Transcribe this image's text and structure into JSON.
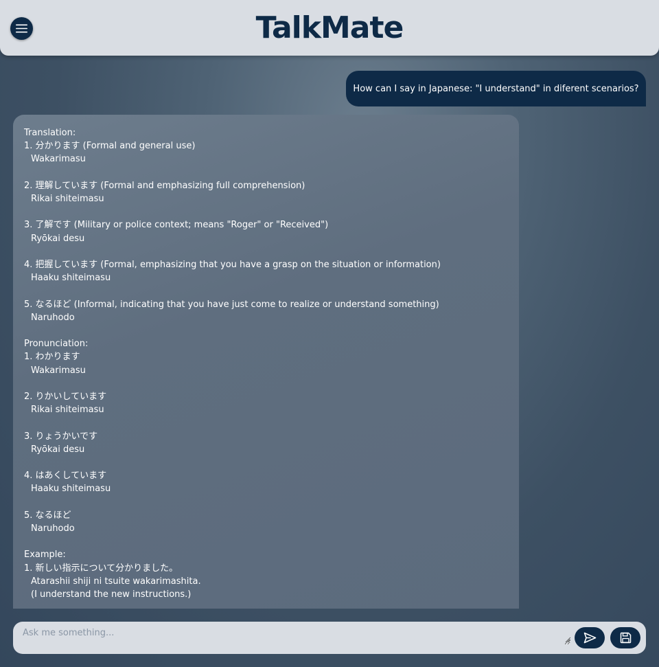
{
  "app": {
    "title": "TalkMate"
  },
  "header": {
    "menu_icon": "hamburger-menu-icon"
  },
  "chat": {
    "user_message": "How can I say in Japanese: \"I understand\" in diferent scenarios?",
    "bot_lines": [
      {
        "text": "Translation:",
        "sub": false
      },
      {
        "text": "1. 分かります (Formal and general use)",
        "sub": false
      },
      {
        "text": "Wakarimasu",
        "sub": true
      },
      {
        "text": "",
        "sub": false
      },
      {
        "text": "2. 理解しています (Formal and emphasizing full comprehension)",
        "sub": false
      },
      {
        "text": "Rikai shiteimasu",
        "sub": true
      },
      {
        "text": "",
        "sub": false
      },
      {
        "text": "3. 了解です (Military or police context; means \"Roger\" or \"Received\")",
        "sub": false
      },
      {
        "text": "Ryōkai desu",
        "sub": true
      },
      {
        "text": "",
        "sub": false
      },
      {
        "text": "4. 把握しています (Formal, emphasizing that you have a grasp on the situation or information)",
        "sub": false
      },
      {
        "text": "Haaku shiteimasu",
        "sub": true
      },
      {
        "text": "",
        "sub": false
      },
      {
        "text": "5. なるほど (Informal, indicating that you have just come to realize or understand something)",
        "sub": false
      },
      {
        "text": "Naruhodo",
        "sub": true
      },
      {
        "text": "",
        "sub": false
      },
      {
        "text": "Pronunciation:",
        "sub": false
      },
      {
        "text": "1. わかります",
        "sub": false
      },
      {
        "text": "Wakarimasu",
        "sub": true
      },
      {
        "text": "",
        "sub": false
      },
      {
        "text": "2. りかいしています",
        "sub": false
      },
      {
        "text": "Rikai shiteimasu",
        "sub": true
      },
      {
        "text": "",
        "sub": false
      },
      {
        "text": "3. りょうかいです",
        "sub": false
      },
      {
        "text": "Ryōkai desu",
        "sub": true
      },
      {
        "text": "",
        "sub": false
      },
      {
        "text": "4. はあくしています",
        "sub": false
      },
      {
        "text": "Haaku shiteimasu",
        "sub": true
      },
      {
        "text": "",
        "sub": false
      },
      {
        "text": "5. なるほど",
        "sub": false
      },
      {
        "text": "Naruhodo",
        "sub": true
      },
      {
        "text": "",
        "sub": false
      },
      {
        "text": "Example:",
        "sub": false
      },
      {
        "text": "1. 新しい指示について分かりました。",
        "sub": false
      },
      {
        "text": "Atarashii shiji ni tsuite wakarimashita.",
        "sub": true
      },
      {
        "text": "(I understand the new instructions.)",
        "sub": true
      }
    ]
  },
  "composer": {
    "placeholder": "Ask me something...",
    "value": "",
    "send_icon": "send-icon",
    "save_icon": "save-floppy-icon"
  },
  "colors": {
    "primary": "#0e2a47",
    "header_bg": "#d9dde3",
    "bot_bubble": "#5f6e7f"
  }
}
